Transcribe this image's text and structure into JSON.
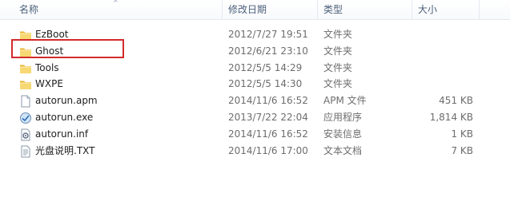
{
  "columns": {
    "name": "名称",
    "date": "修改日期",
    "type": "类型",
    "size": "大小"
  },
  "colors": {
    "highlight": "#d22b2b",
    "folder": "#f2c94c",
    "header_text": "#4c607a"
  },
  "files": [
    {
      "name": "EzBoot",
      "date": "2012/7/27 19:51",
      "type": "文件夹",
      "size": "",
      "icon": "folder-icon"
    },
    {
      "name": "Ghost",
      "date": "2012/6/21 23:10",
      "type": "文件夹",
      "size": "",
      "icon": "folder-icon",
      "highlighted": true
    },
    {
      "name": "Tools",
      "date": "2012/5/5 14:29",
      "type": "文件夹",
      "size": "",
      "icon": "folder-icon"
    },
    {
      "name": "WXPE",
      "date": "2012/5/5 14:30",
      "type": "文件夹",
      "size": "",
      "icon": "folder-icon"
    },
    {
      "name": "autorun.apm",
      "date": "2014/11/6 16:52",
      "type": "APM 文件",
      "size": "451 KB",
      "icon": "file-icon"
    },
    {
      "name": "autorun.exe",
      "date": "2013/7/22 22:04",
      "type": "应用程序",
      "size": "1,814 KB",
      "icon": "exe-icon"
    },
    {
      "name": "autorun.inf",
      "date": "2014/11/6 16:52",
      "type": "安装信息",
      "size": "1 KB",
      "icon": "settings-file-icon"
    },
    {
      "name": "光盘说明.TXT",
      "date": "2014/11/6 17:00",
      "type": "文本文档",
      "size": "7 KB",
      "icon": "text-file-icon"
    }
  ]
}
